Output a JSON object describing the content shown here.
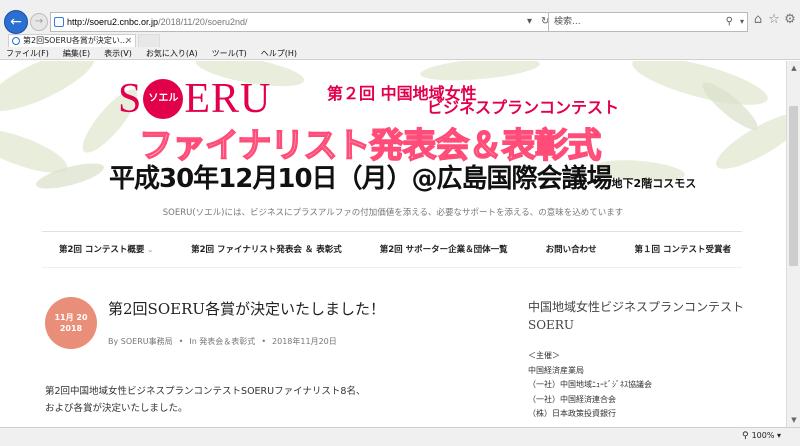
{
  "browser": {
    "address_host": "http://soeru2.cnbc.or.jp",
    "address_path": "/2018/11/20/soeru2nd/",
    "search_placeholder": "検索...",
    "tab_title": "第2回SOERU各賞が決定い...",
    "menu": [
      "ファイル(F)",
      "編集(E)",
      "表示(V)",
      "お気に入り(A)",
      "ツール(T)",
      "ヘルプ(H)"
    ],
    "zoom_level": "100%"
  },
  "header": {
    "logo_s": "S",
    "logo_circle": "ソエル",
    "logo_rest": "ERU",
    "subtitle_line1": "第２回 中国地域女性",
    "subtitle_line2": "ビジネスプランコンテスト",
    "event_name": "ファイナリスト発表会＆表彰式",
    "event_date": "平成30年12月10日（月）@広島国際会議場",
    "event_place": "地下2階コスモス",
    "tagline": "SOERU(ソエル)には、ビジネスにプラスアルファの付加価値を添える、必要なサポートを添える、の意味を込めています"
  },
  "nav": {
    "items": [
      "第2回 コンテスト概要",
      "第2回 ファイナリスト発表会 ＆ 表彰式",
      "第2回 サポーター企業＆団体一覧",
      "お問い合わせ",
      "第１回 コンテスト受賞者"
    ]
  },
  "post": {
    "date_line1": "11月 20",
    "date_line2": "2018",
    "title": "第2回SOERU各賞が決定いたしました！",
    "author": "By SOERU事務局",
    "category": "In 発表会＆表彰式",
    "date": "2018年11月20日",
    "body_line1": "第2回中国地域女性ビジネスプランコンテストSOERUファイナリスト8名、",
    "body_line2": "および各賞が決定いたしました。"
  },
  "sidebar": {
    "title": "中国地域女性ビジネスプランコンテスト SOERU",
    "list": [
      "＜主催＞",
      "中国経済産業局",
      "（一社）中国地域ﾆｭｰﾋﾞｼﾞﾈｽ協議会",
      "（一社）中国経済連合会",
      "（株）日本政策投資銀行"
    ]
  },
  "colors": {
    "brand_pink": "#e2004a",
    "badge": "#e98e78",
    "ie_blue": "#2a6fd1"
  }
}
